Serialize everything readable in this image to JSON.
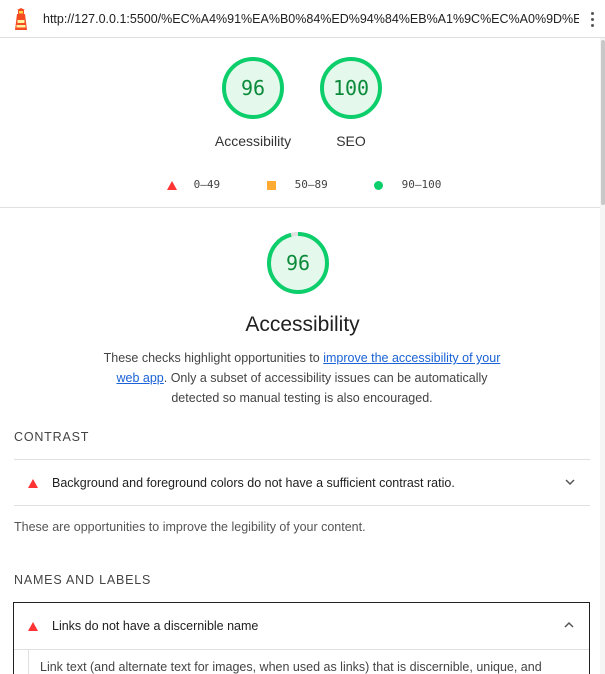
{
  "browser": {
    "url": "http://127.0.0.1:5500/%EC%A4%91%EA%B0%84%ED%94%84%EB%A1%9C%EC%A0%9D%ED%8A...",
    "logo_icon": "lighthouse-icon",
    "menu_icon": "kebab-menu-icon"
  },
  "summary": {
    "gauges": [
      {
        "score": "96",
        "label": "Accessibility"
      },
      {
        "score": "100",
        "label": "SEO"
      }
    ]
  },
  "legend": {
    "fail": "0–49",
    "average": "50–89",
    "pass": "90–100"
  },
  "category": {
    "score": "96",
    "score_fraction": 0.96,
    "title": "Accessibility",
    "desc_before": "These checks highlight opportunities to ",
    "desc_link": "improve the accessibility of your web app",
    "desc_after": ". Only a subset of accessibility issues can be automatically detected so manual testing is also encouraged."
  },
  "groups": [
    {
      "heading": "CONTRAST",
      "audit": "Background and foreground colors do not have a sufficient contrast ratio.",
      "note": "These are opportunities to improve the legibility of your content."
    },
    {
      "heading": "NAMES AND LABELS",
      "audit": "Links do not have a discernible name",
      "detail": "Link text (and alternate text for images, when used as links) that is discernible, unique, and"
    }
  ],
  "colors": {
    "pass": "#0cce6b",
    "pass_text": "#0b8a3a",
    "pass_bg": "#e5f8ec",
    "fail": "#ff3333",
    "average": "#ffaa33",
    "link": "#1a62d6"
  }
}
